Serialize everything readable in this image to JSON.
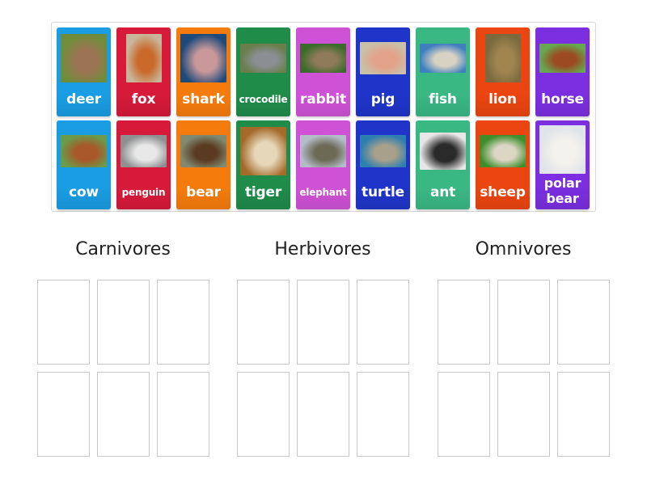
{
  "tray": {
    "cards": [
      {
        "label": "deer",
        "color": "#1a9de3",
        "icon": "deer-photo",
        "pic": [
          "#6f8d3a",
          "#9a7452"
        ]
      },
      {
        "label": "fox",
        "color": "#d71a3a",
        "icon": "fox-photo",
        "pic": [
          "#c9b59a",
          "#c96a2b"
        ]
      },
      {
        "label": "shark",
        "color": "#f57c0c",
        "icon": "shark-photo",
        "pic": [
          "#1d4a7a",
          "#c9989a"
        ]
      },
      {
        "label": "crocodile",
        "color": "#1f8c4a",
        "icon": "crocodile-photo",
        "pic": [
          "#6a7d4c",
          "#8a8f93"
        ]
      },
      {
        "label": "rabbit",
        "color": "#cf52d6",
        "icon": "rabbit-photo",
        "pic": [
          "#3b6b2a",
          "#8f7a5a"
        ]
      },
      {
        "label": "pig",
        "color": "#1f35c9",
        "icon": "pig-photo",
        "pic": [
          "#c9c0a8",
          "#e3a28a"
        ]
      },
      {
        "label": "fish",
        "color": "#3ab884",
        "icon": "fish-photo",
        "pic": [
          "#3f7fc0",
          "#d7d2c2"
        ]
      },
      {
        "label": "lion",
        "color": "#eb4511",
        "icon": "lion-photo",
        "pic": [
          "#7a6a3e",
          "#a08550"
        ]
      },
      {
        "label": "horse",
        "color": "#7b2fe0",
        "icon": "horse-photo",
        "pic": [
          "#66a850",
          "#9c4a22"
        ]
      },
      {
        "label": "cow",
        "color": "#1a9de3",
        "icon": "cow-photo",
        "pic": [
          "#6b9a49",
          "#a8582a"
        ]
      },
      {
        "label": "penguin",
        "color": "#d71a3a",
        "icon": "penguin-photo",
        "pic": [
          "#8d8f90",
          "#e8e8e8"
        ]
      },
      {
        "label": "bear",
        "color": "#f57c0c",
        "icon": "bear-photo",
        "pic": [
          "#7f8a70",
          "#5a3a20"
        ]
      },
      {
        "label": "tiger",
        "color": "#1f8c4a",
        "icon": "tiger-photo",
        "pic": [
          "#a36a2a",
          "#e6d7b8"
        ]
      },
      {
        "label": "elephant",
        "color": "#cf52d6",
        "icon": "elephant-photo",
        "pic": [
          "#b4bcc8",
          "#6b6a55"
        ]
      },
      {
        "label": "turtle",
        "color": "#1f35c9",
        "icon": "turtle-photo",
        "pic": [
          "#2d7fb0",
          "#a8a08a"
        ]
      },
      {
        "label": "ant",
        "color": "#3ab884",
        "icon": "ant-photo",
        "pic": [
          "#e8e6e6",
          "#2a2a2a"
        ]
      },
      {
        "label": "sheep",
        "color": "#eb4511",
        "icon": "sheep-photo",
        "pic": [
          "#3f8e2c",
          "#dcd6c4"
        ]
      },
      {
        "label": "polar bear",
        "color": "#7b2fe0",
        "icon": "polar-bear-photo",
        "pic": [
          "#dfe3ea",
          "#f4f2ec"
        ]
      }
    ]
  },
  "groups": [
    {
      "title": "Carnivores"
    },
    {
      "title": "Herbivores"
    },
    {
      "title": "Omnivores"
    }
  ]
}
